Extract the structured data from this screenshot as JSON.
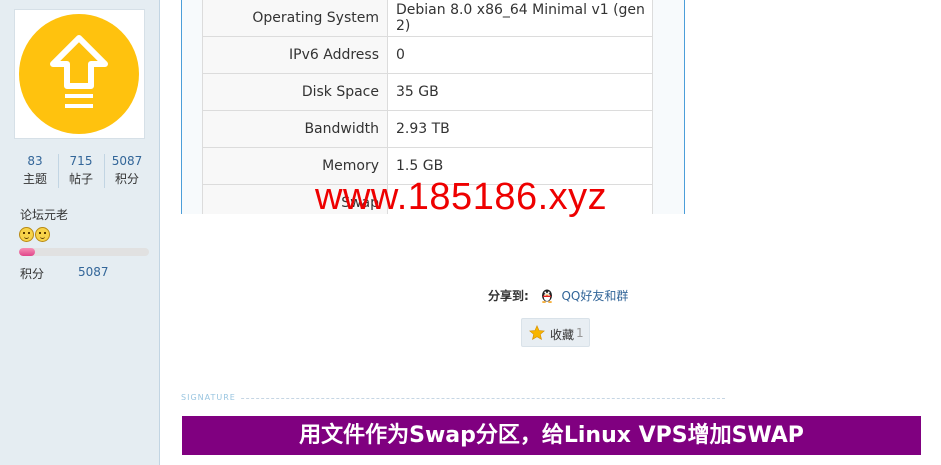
{
  "profile": {
    "avatar_icon": "upload-arrow-icon",
    "avatar_color": "#FFC20E",
    "stats": [
      {
        "value": "83",
        "label": "主题"
      },
      {
        "value": "715",
        "label": "帖子"
      },
      {
        "value": "5087",
        "label": "积分"
      }
    ],
    "rank_title": "论坛元老",
    "rank_icons": [
      "smiley-icon",
      "smiley-icon"
    ],
    "credit_progress": 0.12,
    "credit_label": "积分",
    "credit_value": "5087"
  },
  "spec_table": {
    "rows": [
      {
        "key": "Operating System",
        "value": "Debian 8.0 x86_64 Minimal v1 (gen 2)"
      },
      {
        "key": "IPv6 Address",
        "value": "0"
      },
      {
        "key": "Disk Space",
        "value": "35 GB"
      },
      {
        "key": "Bandwidth",
        "value": "2.93 TB"
      },
      {
        "key": "Memory",
        "value": "1.5 GB"
      },
      {
        "key": "Swap",
        "value": ""
      }
    ]
  },
  "watermark": "www.185186.xyz",
  "share": {
    "label": "分享到:",
    "icon": "qq-penguin-icon",
    "link": "QQ好友和群"
  },
  "favorite": {
    "icon": "star-icon",
    "label": "收藏",
    "count": "1"
  },
  "signature": {
    "heading": "SIGNATURE",
    "banner": "用文件作为Swap分区，给Linux VPS增加SWAP",
    "banner_color": "#800080"
  }
}
